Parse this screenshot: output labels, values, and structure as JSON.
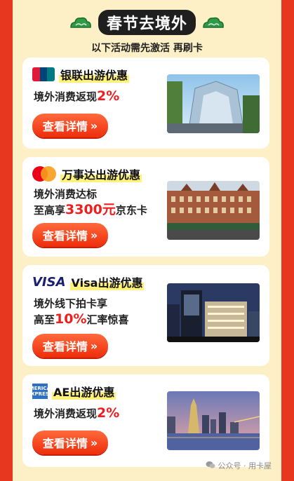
{
  "header": {
    "title": "春节去境外",
    "subtitle": "以下活动需先激活 再刷卡"
  },
  "cards": [
    {
      "logo_text": "UnionPay 银联",
      "title": "银联出游优惠",
      "desc_line1_prefix": "境外消费返现",
      "desc_line1_value": "2%",
      "button_label": "查看详情",
      "photo": "mall-building"
    },
    {
      "logo_text": "",
      "title": "万事达出游优惠",
      "desc_line1_prefix": "境外消费达标",
      "desc_line2_prefix": "至高享",
      "desc_line2_value": "3300元",
      "desc_line2_suffix": "京东卡",
      "button_label": "查看详情",
      "photo": "department-store"
    },
    {
      "logo_text": "VISA",
      "title": "Visa出游优惠",
      "desc_line1_prefix": "境外线下拍卡享",
      "desc_line2_prefix": "高至",
      "desc_line2_value": "10%",
      "desc_line2_suffix": "汇率惊喜",
      "button_label": "查看详情",
      "photo": "city-night"
    },
    {
      "logo_text": "AMERICAN EXPRESS",
      "title": "AE出游优惠",
      "desc_line1_prefix": "境外消费返现",
      "desc_line1_value": "2%",
      "button_label": "查看详情",
      "photo": "harbor-skyline"
    }
  ],
  "watermark": "公众号 · 用卡屋",
  "colors": {
    "accent": "#ee2d0b",
    "border": "#e8371f",
    "highlight": "#ee1e1e"
  }
}
